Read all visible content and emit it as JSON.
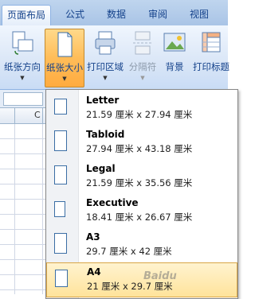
{
  "tabs": [
    {
      "label": "页面布局",
      "active": true
    },
    {
      "label": "公式",
      "active": false
    },
    {
      "label": "数据",
      "active": false
    },
    {
      "label": "审阅",
      "active": false
    },
    {
      "label": "视图",
      "active": false
    }
  ],
  "ribbon": {
    "orientation": {
      "label": "纸张方向",
      "icon": "orientation-icon"
    },
    "size": {
      "label": "纸张大小",
      "icon": "paper-size-icon",
      "pressed": true
    },
    "print_area": {
      "label": "打印区域",
      "icon": "printer-icon"
    },
    "breaks": {
      "label": "分隔符",
      "icon": "page-break-icon",
      "disabled": true
    },
    "background": {
      "label": "背景",
      "icon": "background-icon"
    },
    "print_titles": {
      "label": "打印标题",
      "icon": "print-titles-icon"
    }
  },
  "grid": {
    "visible_column": "C"
  },
  "paper_sizes": [
    {
      "name": "Letter",
      "dims": "21.59 厘米 x 27.94 厘米",
      "selected": false
    },
    {
      "name": "Tabloid",
      "dims": "27.94 厘米 x 43.18 厘米",
      "selected": false
    },
    {
      "name": "Legal",
      "dims": "21.59 厘米 x 35.56 厘米",
      "selected": false
    },
    {
      "name": "Executive",
      "dims": "18.41 厘米 x 26.67 厘米",
      "selected": false
    },
    {
      "name": "A3",
      "dims": "29.7 厘米 x 42 厘米",
      "selected": false
    },
    {
      "name": "A4",
      "dims": "21 厘米 x 29.7 厘米",
      "selected": true
    }
  ],
  "watermark": "Baidu"
}
